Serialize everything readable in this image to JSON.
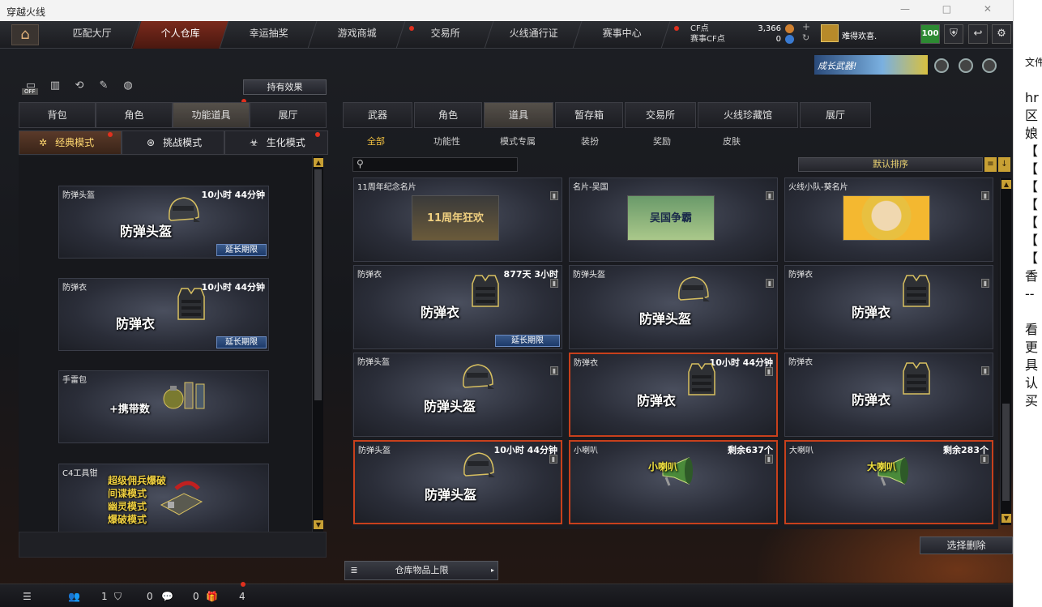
{
  "window": {
    "title": "穿越火线",
    "controls": "— □ ✕"
  },
  "nav": {
    "tabs": [
      "匹配大厅",
      "个人仓库",
      "幸运抽奖",
      "游戏商城",
      "交易所",
      "火线通行证",
      "赛事中心"
    ],
    "active": "个人仓库"
  },
  "currency": {
    "cf_label": "CF点",
    "cf_value": "3,366",
    "match_label": "赛事CF点",
    "match_value": "0"
  },
  "player": {
    "name": "难得欢喜.",
    "level": "100"
  },
  "banner": {
    "text": "成长武器!"
  },
  "left": {
    "owned_effects": "持有效果",
    "off_badge": "OFF",
    "tabs": [
      "背包",
      "角色",
      "功能道具",
      "展厅"
    ],
    "active_tab": "功能道具",
    "modes": [
      "经典模式",
      "挑战模式",
      "生化模式"
    ],
    "items": [
      {
        "name": "防弹头盔",
        "time": "10小时 44分钟",
        "label": "防弹头盔",
        "button": "延长期限",
        "kind": "helmet"
      },
      {
        "name": "防弹衣",
        "time": "10小时 44分钟",
        "label": "防弹衣",
        "button": "延长期限",
        "kind": "vest"
      },
      {
        "name": "手雷包",
        "time": "",
        "label": "+携带数",
        "button": "",
        "kind": "grenade"
      },
      {
        "name": "C4工具钳",
        "time": "",
        "label": "超级佣兵爆破\n间谍模式\n幽灵模式\n爆破模式",
        "button": "",
        "kind": "c4"
      }
    ]
  },
  "right": {
    "tabs": [
      "武器",
      "角色",
      "道具",
      "暂存箱",
      "交易所",
      "火线珍藏馆",
      "展厅"
    ],
    "active_tab": "道具",
    "filters": [
      "全部",
      "功能性",
      "模式专属",
      "装扮",
      "奖励",
      "皮肤"
    ],
    "active_filter": "全部",
    "search_placeholder": "",
    "sort": "默认排序",
    "items": [
      {
        "name": "11周年纪念名片",
        "time": "",
        "label": "11周年狂欢",
        "kind": "namecard",
        "button": ""
      },
      {
        "name": "名片-吴国",
        "time": "",
        "label": "吴国争霸",
        "kind": "namecard",
        "button": ""
      },
      {
        "name": "火线小队-葵名片",
        "time": "",
        "label": "",
        "kind": "anime",
        "button": ""
      },
      {
        "name": "防弹衣",
        "time": "877天 3小时",
        "label": "防弹衣",
        "kind": "vest",
        "button": "延长期限"
      },
      {
        "name": "防弹头盔",
        "time": "",
        "label": "防弹头盔",
        "kind": "helmet",
        "button": ""
      },
      {
        "name": "防弹衣",
        "time": "",
        "label": "防弹衣",
        "kind": "vest",
        "button": ""
      },
      {
        "name": "防弹头盔",
        "time": "",
        "label": "防弹头盔",
        "kind": "helmet",
        "button": ""
      },
      {
        "name": "防弹衣",
        "time": "10小时 44分钟",
        "label": "防弹衣",
        "kind": "vest",
        "button": "",
        "highlight": true
      },
      {
        "name": "防弹衣",
        "time": "",
        "label": "防弹衣",
        "kind": "vest",
        "button": ""
      },
      {
        "name": "防弹头盔",
        "time": "10小时 44分钟",
        "label": "防弹头盔",
        "kind": "helmet",
        "button": "",
        "highlight": true
      },
      {
        "name": "小喇叭",
        "time": "剩余637个",
        "label": "小喇叭",
        "kind": "horn",
        "button": "",
        "highlight": true
      },
      {
        "name": "大喇叭",
        "time": "剩余283个",
        "label": "大喇叭",
        "kind": "horn",
        "button": "",
        "highlight": true
      }
    ],
    "delete_button": "选择删除",
    "capacity_button": "仓库物品上限"
  },
  "bottom": {
    "stats": [
      "1",
      "0",
      "0",
      "4"
    ]
  },
  "side_panel": {
    "lines": [
      "文件",
      "hr",
      "区",
      "娘",
      "【",
      "【",
      "【",
      "【",
      "【",
      "【",
      "【",
      "香",
      "--",
      "看",
      "更",
      "具",
      "认",
      "买"
    ]
  }
}
